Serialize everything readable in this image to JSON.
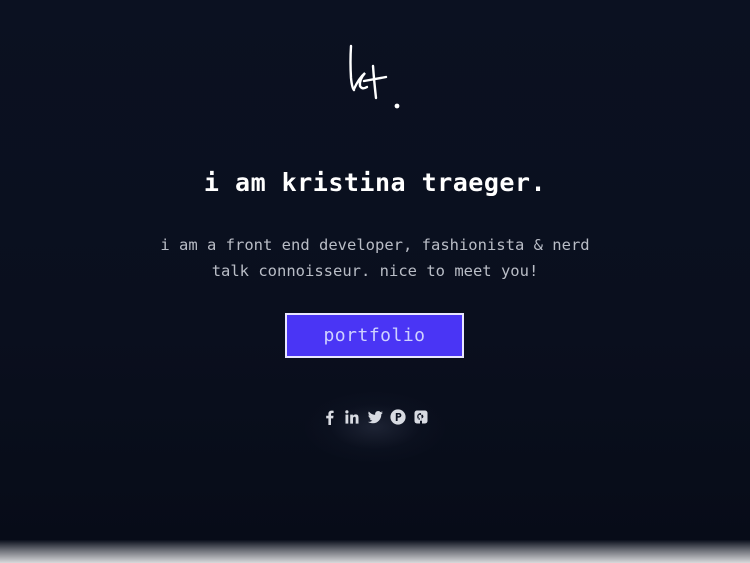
{
  "page": {
    "background_color": "#0b1120",
    "accent_color": "#4a35f5"
  },
  "logo": {
    "icon": "signature-logo-icon",
    "text": "kt."
  },
  "hero": {
    "title": "i am kristina traeger.",
    "tagline": "i am a front end developer, fashionista & nerd talk connoisseur. nice to meet you!"
  },
  "cta": {
    "portfolio_label": "portfolio"
  },
  "social": [
    {
      "name": "facebook",
      "icon": "facebook-icon"
    },
    {
      "name": "linkedin",
      "icon": "linkedin-icon"
    },
    {
      "name": "twitter",
      "icon": "twitter-icon"
    },
    {
      "name": "producthunt",
      "icon": "producthunt-icon"
    },
    {
      "name": "github",
      "icon": "github-icon"
    }
  ]
}
